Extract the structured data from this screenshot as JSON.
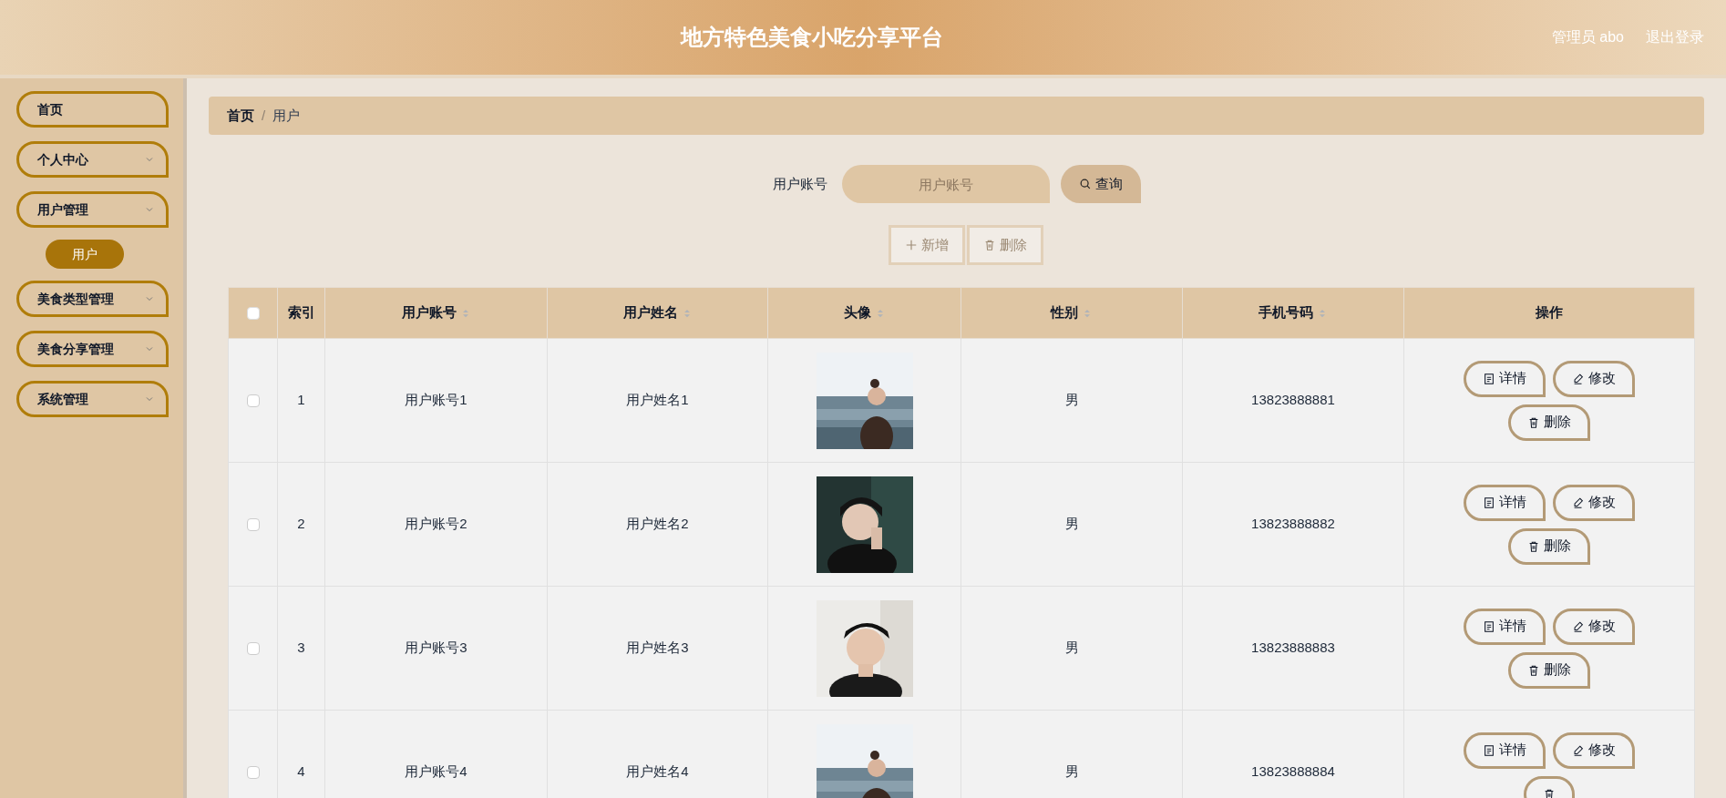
{
  "header": {
    "title": "地方特色美食小吃分享平台",
    "user": "管理员 abo",
    "logout": "退出登录"
  },
  "sidebar": {
    "items": [
      {
        "label": "首页",
        "has_children": false
      },
      {
        "label": "个人中心",
        "has_children": true
      },
      {
        "label": "用户管理",
        "has_children": true,
        "children": [
          {
            "label": "用户",
            "selected": true
          }
        ]
      },
      {
        "label": "美食类型管理",
        "has_children": true
      },
      {
        "label": "美食分享管理",
        "has_children": true
      },
      {
        "label": "系统管理",
        "has_children": true
      }
    ]
  },
  "breadcrumb_separator": "/",
  "breadcrumb": [
    {
      "label": "首页",
      "current": false
    },
    {
      "label": "用户",
      "current": true
    }
  ],
  "search": {
    "label": "用户账号",
    "placeholder": "用户账号",
    "button": "查询"
  },
  "toolbar": [
    {
      "kind": "add",
      "label": "新增",
      "disabled": true
    },
    {
      "kind": "delete",
      "label": "删除",
      "disabled": true
    }
  ],
  "table": {
    "select_all": false,
    "columns": [
      {
        "label": "索引",
        "sortable": false
      },
      {
        "label": "用户账号",
        "sortable": true
      },
      {
        "label": "用户姓名",
        "sortable": true
      },
      {
        "label": "头像",
        "sortable": true
      },
      {
        "label": "性别",
        "sortable": true
      },
      {
        "label": "手机号码",
        "sortable": true
      },
      {
        "label": "操作",
        "sortable": false
      }
    ],
    "rows": [
      {
        "checked": false,
        "index": "1",
        "account": "用户账号1",
        "name": "用户姓名1",
        "avatar": {
          "kind": "picture"
        },
        "gender": "男",
        "phone": "13823888881",
        "actions": [
          {
            "kind": "detail",
            "label": "详情"
          },
          {
            "kind": "edit",
            "label": "修改"
          },
          {
            "kind": "delete",
            "label": "删除"
          }
        ]
      },
      {
        "checked": false,
        "index": "2",
        "account": "用户账号2",
        "name": "用户姓名2",
        "avatar": {
          "kind": "picture"
        },
        "gender": "男",
        "phone": "13823888882",
        "actions": [
          {
            "kind": "detail",
            "label": "详情"
          },
          {
            "kind": "edit",
            "label": "修改"
          },
          {
            "kind": "delete",
            "label": "删除"
          }
        ]
      },
      {
        "checked": false,
        "index": "3",
        "account": "用户账号3",
        "name": "用户姓名3",
        "avatar": {
          "kind": "picture"
        },
        "gender": "男",
        "phone": "13823888883",
        "actions": [
          {
            "kind": "detail",
            "label": "详情"
          },
          {
            "kind": "edit",
            "label": "修改"
          },
          {
            "kind": "delete",
            "label": "删除"
          }
        ]
      },
      {
        "checked": false,
        "index": "4",
        "account": "用户账号4",
        "name": "用户姓名4",
        "avatar": {
          "kind": "picture"
        },
        "gender": "男",
        "phone": "13823888884",
        "actions": [
          {
            "kind": "detail",
            "label": "详情"
          },
          {
            "kind": "edit",
            "label": "修改"
          },
          {
            "kind": "delete"
          }
        ]
      }
    ]
  }
}
